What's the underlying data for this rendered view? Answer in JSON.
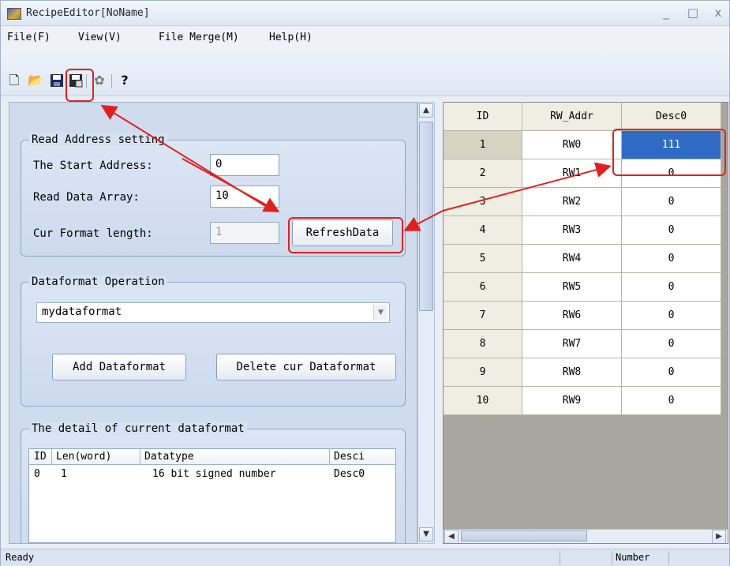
{
  "window": {
    "title": "RecipeEditor[NoName]"
  },
  "menu": [
    "File(F)",
    "View(V)",
    "File Merge(M)",
    "Help(H)"
  ],
  "toolbar": {
    "icons": [
      "new-file-icon",
      "open-folder-icon",
      "save-icon",
      "save-as-icon",
      "settings-icon",
      "help-icon"
    ]
  },
  "read_address": {
    "group_title": "Read Address setting",
    "start_label": "The Start Address:",
    "start_value": "0",
    "array_label": "Read Data Array:",
    "array_value": "10",
    "cur_label": "Cur Format length:",
    "cur_value": "1",
    "refresh_label": "RefreshData"
  },
  "dataformat": {
    "group_title": "Dataformat Operation",
    "selected": "mydataformat",
    "add_label": "Add Dataformat",
    "delete_label": "Delete cur Dataformat"
  },
  "detail": {
    "group_title": "The detail of current dataformat",
    "columns": [
      "ID",
      "Len(word)",
      "Datatype",
      "Desci"
    ],
    "rows": [
      [
        "0",
        "1",
        "16 bit signed number",
        "Desc0"
      ]
    ]
  },
  "grid": {
    "headers": [
      "ID",
      "RW_Addr",
      "Desc0"
    ],
    "rows": [
      [
        "1",
        "RW0",
        "111"
      ],
      [
        "2",
        "RW1",
        "0"
      ],
      [
        "3",
        "RW2",
        "0"
      ],
      [
        "4",
        "RW3",
        "0"
      ],
      [
        "5",
        "RW4",
        "0"
      ],
      [
        "6",
        "RW5",
        "0"
      ],
      [
        "7",
        "RW6",
        "0"
      ],
      [
        "8",
        "RW7",
        "0"
      ],
      [
        "9",
        "RW8",
        "0"
      ],
      [
        "10",
        "RW9",
        "0"
      ]
    ]
  },
  "status": {
    "text": "Ready",
    "pane": "Number"
  },
  "colors": {
    "highlight": "#e02020",
    "selected_cell": "#2f6bc5"
  }
}
